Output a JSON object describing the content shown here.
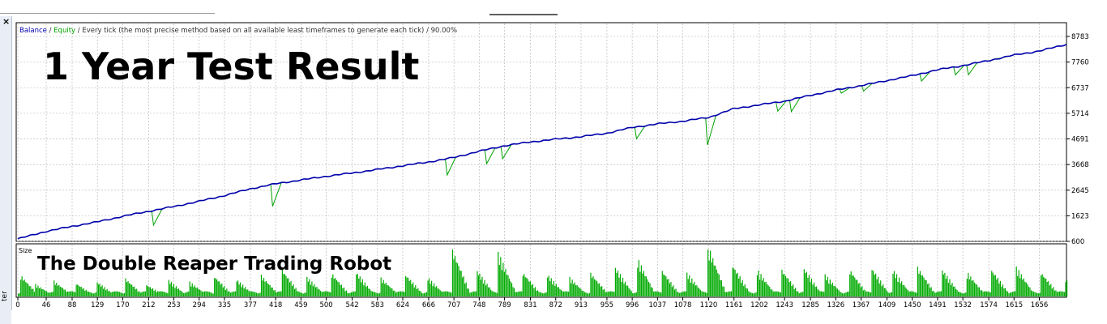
{
  "window": {
    "close_glyph": "×",
    "side_label": "ter",
    "close_icon": "close-icon"
  },
  "balance_chart": {
    "legend": {
      "balance": "Balance",
      "sep1": " / ",
      "equity": "Equity",
      "rest": " / Every tick (the most precise method based on all available least timeframes to generate each tick) / 90.00%"
    },
    "overlay_title": "1 Year Test Result"
  },
  "size_chart": {
    "label": "Size",
    "overlay_title": "The Double Reaper Trading Robot"
  },
  "colors": {
    "balance": "#0000aa",
    "equity": "#00a000",
    "size_bars": "#00aa00",
    "grid": "#b0b0b0",
    "frame": "#000000"
  },
  "chart_data": [
    {
      "type": "line",
      "title": "",
      "ylim": [
        600,
        8783
      ],
      "y_ticks": [
        600,
        1623,
        2645,
        3668,
        4691,
        5714,
        6737,
        7760,
        8783
      ],
      "grid": true,
      "series": [
        {
          "name": "Balance",
          "points": [
            [
              0,
              700
            ],
            [
              46,
              1000
            ],
            [
              88,
              1200
            ],
            [
              129,
              1380
            ],
            [
              170,
              1600
            ],
            [
              212,
              1800
            ],
            [
              253,
              1990
            ],
            [
              294,
              2200
            ],
            [
              335,
              2430
            ],
            [
              377,
              2700
            ],
            [
              418,
              2900
            ],
            [
              459,
              3050
            ],
            [
              500,
              3200
            ],
            [
              542,
              3330
            ],
            [
              583,
              3470
            ],
            [
              624,
              3620
            ],
            [
              666,
              3770
            ],
            [
              707,
              3950
            ],
            [
              748,
              4200
            ],
            [
              789,
              4420
            ],
            [
              831,
              4570
            ],
            [
              872,
              4680
            ],
            [
              913,
              4780
            ],
            [
              955,
              4920
            ],
            [
              996,
              5150
            ],
            [
              1037,
              5290
            ],
            [
              1078,
              5400
            ],
            [
              1120,
              5550
            ],
            [
              1161,
              5900
            ],
            [
              1202,
              6050
            ],
            [
              1243,
              6200
            ],
            [
              1285,
              6430
            ],
            [
              1326,
              6640
            ],
            [
              1367,
              6820
            ],
            [
              1409,
              7020
            ],
            [
              1450,
              7220
            ],
            [
              1491,
              7450
            ],
            [
              1532,
              7620
            ],
            [
              1574,
              7820
            ],
            [
              1615,
              8040
            ],
            [
              1656,
              8200
            ],
            [
              1700,
              8470
            ]
          ]
        },
        {
          "name": "Equity",
          "drawdowns": [
            {
              "x": 220,
              "low": 1250
            },
            {
              "x": 413,
              "low": 2000
            },
            {
              "x": 696,
              "low": 3250
            },
            {
              "x": 760,
              "low": 3700
            },
            {
              "x": 786,
              "low": 3900
            },
            {
              "x": 1003,
              "low": 4700
            },
            {
              "x": 1118,
              "low": 4450
            },
            {
              "x": 1232,
              "low": 5800
            },
            {
              "x": 1254,
              "low": 5780
            },
            {
              "x": 1335,
              "low": 6520
            },
            {
              "x": 1371,
              "low": 6600
            },
            {
              "x": 1465,
              "low": 7000
            },
            {
              "x": 1520,
              "low": 7250
            },
            {
              "x": 1541,
              "low": 7250
            },
            {
              "x": 1590,
              "low": 7900
            }
          ]
        }
      ]
    },
    {
      "type": "bar",
      "title": "",
      "xlabel": "",
      "x_ticks": [
        0,
        46,
        88,
        129,
        170,
        212,
        253,
        294,
        335,
        377,
        418,
        459,
        500,
        542,
        583,
        624,
        666,
        707,
        748,
        789,
        831,
        872,
        913,
        955,
        996,
        1037,
        1078,
        1120,
        1161,
        1202,
        1243,
        1285,
        1326,
        1367,
        1409,
        1450,
        1491,
        1532,
        1574,
        1615,
        1656
      ],
      "series": [
        {
          "name": "Size",
          "peaks": [
            [
              5,
              0.45
            ],
            [
              30,
              0.25
            ],
            [
              60,
              0.32
            ],
            [
              95,
              0.28
            ],
            [
              130,
              0.3
            ],
            [
              175,
              0.38
            ],
            [
              210,
              0.24
            ],
            [
              245,
              0.35
            ],
            [
              280,
              0.3
            ],
            [
              320,
              0.42
            ],
            [
              355,
              0.36
            ],
            [
              395,
              0.45
            ],
            [
              430,
              0.55
            ],
            [
              470,
              0.4
            ],
            [
              510,
              0.48
            ],
            [
              550,
              0.5
            ],
            [
              590,
              0.38
            ],
            [
              630,
              0.45
            ],
            [
              665,
              0.4
            ],
            [
              705,
              1.0
            ],
            [
              745,
              0.55
            ],
            [
              780,
              0.9
            ],
            [
              820,
              0.5
            ],
            [
              860,
              0.45
            ],
            [
              895,
              0.4
            ],
            [
              930,
              0.48
            ],
            [
              970,
              0.6
            ],
            [
              1005,
              0.8
            ],
            [
              1045,
              0.55
            ],
            [
              1085,
              0.5
            ],
            [
              1120,
              1.05
            ],
            [
              1160,
              0.65
            ],
            [
              1200,
              0.55
            ],
            [
              1240,
              0.55
            ],
            [
              1275,
              0.6
            ],
            [
              1310,
              0.45
            ],
            [
              1350,
              0.55
            ],
            [
              1385,
              0.6
            ],
            [
              1420,
              0.55
            ],
            [
              1460,
              0.6
            ],
            [
              1500,
              0.55
            ],
            [
              1540,
              0.5
            ],
            [
              1580,
              0.55
            ],
            [
              1620,
              0.6
            ],
            [
              1660,
              0.5
            ],
            [
              1700,
              0.35
            ]
          ]
        }
      ]
    }
  ]
}
